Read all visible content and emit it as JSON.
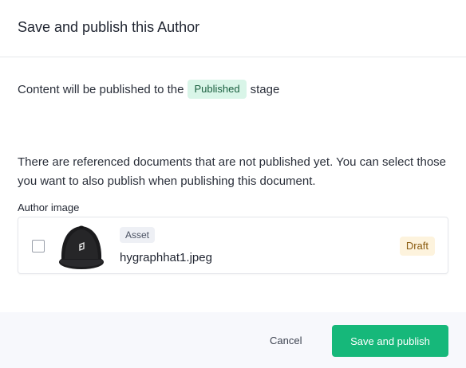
{
  "dialog": {
    "title": "Save and publish this Author"
  },
  "stage": {
    "prefix": "Content will be published to the",
    "badge": "Published",
    "suffix": "stage"
  },
  "references": {
    "description": "There are referenced documents that are not published yet. You can select those you want to also publish when publishing this document.",
    "section_label": "Author image",
    "items": [
      {
        "type": "Asset",
        "filename": "hygraphhat1.jpeg",
        "status": "Draft",
        "checked": false,
        "thumbnail_icon": "hat-image"
      }
    ]
  },
  "footer": {
    "cancel_label": "Cancel",
    "publish_label": "Save and publish"
  },
  "colors": {
    "accent": "#16b87a",
    "published_badge_bg": "#d9f5e8",
    "draft_badge_bg": "#fdf3dd"
  }
}
